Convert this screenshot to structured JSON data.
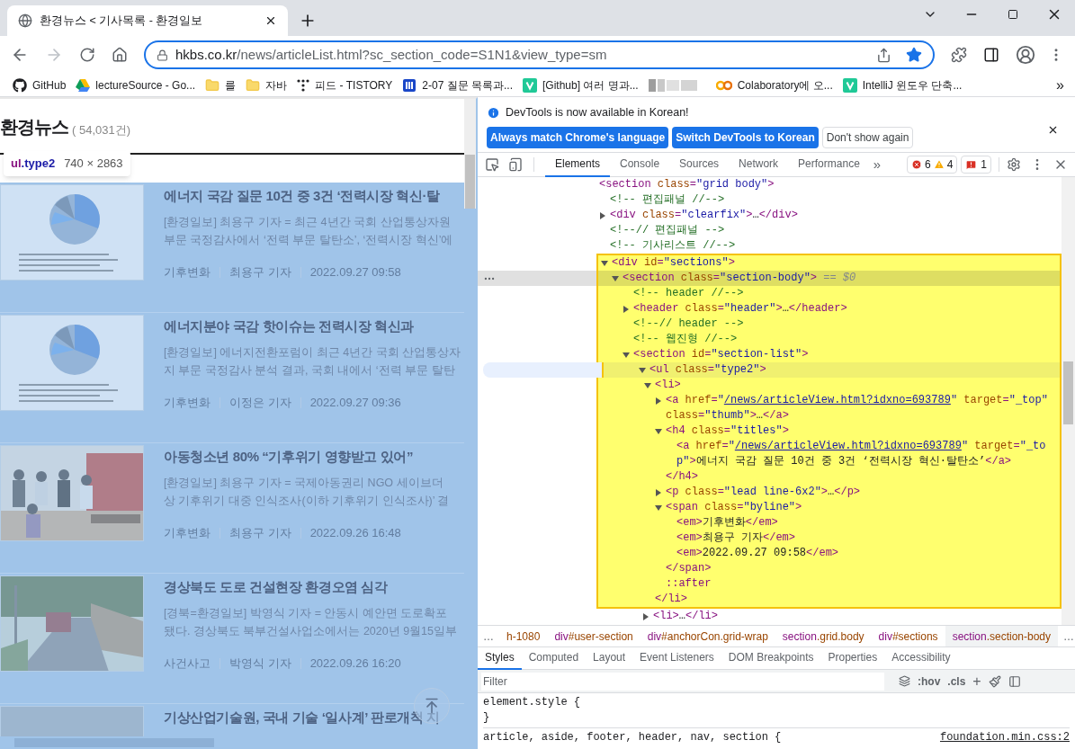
{
  "browser": {
    "tab": {
      "title": "환경뉴스 < 기사목록 - 환경일보",
      "selected": true
    },
    "url": {
      "host": "hkbs.co.kr",
      "path": "/news/articleList.html?sc_section_code=S1N1&view_type=sm"
    },
    "bookmarked": true,
    "bookmarks": [
      {
        "kind": "github",
        "label": "GitHub"
      },
      {
        "kind": "drive",
        "label": "lectureSource - Go..."
      },
      {
        "kind": "folder",
        "label": "를"
      },
      {
        "kind": "folder",
        "label": "자바"
      },
      {
        "kind": "dots",
        "label": "피드 - TISTORY"
      },
      {
        "kind": "bars",
        "label": "2-07 질문 목록과..."
      },
      {
        "kind": "v",
        "label": "[Github] 여러 명과..."
      },
      {
        "kind": "blurred"
      },
      {
        "kind": "colab",
        "label": "Colaboratory에 오..."
      },
      {
        "kind": "v",
        "label": "IntelliJ 윈도우 단축..."
      }
    ],
    "bookmarks_more": "»"
  },
  "page": {
    "heading": "환경뉴스",
    "count": "( 54,031건)",
    "tooltip": {
      "tag": "ul",
      "cls": ".type2",
      "size": "740 × 2863"
    },
    "articles": [
      {
        "title": "에너지 국감 질문 10건 중 3건 ‘전력시장 혁신·탈",
        "lead": [
          "[환경일보] 최용구 기자 = 최근 4년간 국회 산업통상자원",
          "부문 국정감사에서 ‘전력 부문 탈탄소’, ‘전력시장 혁신’에"
        ],
        "byline": [
          "기후변화",
          "최용구 기자",
          "2022.09.27 09:58"
        ]
      },
      {
        "title": "에너지분야 국감 핫이슈는 전력시장 혁신과",
        "lead": [
          "[환경일보] 에너지전환포럼이 최근 4년간 국회 산업통상자",
          "지 부문 국정감사 분석 결과, 국회 내에서 ‘전력 부문 탈탄"
        ],
        "byline": [
          "기후변화",
          "이정은 기자",
          "2022.09.27 09:36"
        ]
      },
      {
        "title": "아동청소년 80% “기후위기 영향받고 있어”",
        "lead": [
          "[환경일보] 최용구 기자 = 국제아동권리 NGO 세이브더",
          "상 기후위기 대중 인식조사(이하 기후위기 인식조사)’ 결"
        ],
        "byline": [
          "기후변화",
          "최용구 기자",
          "2022.09.26 16:48"
        ]
      },
      {
        "title": "경상북도 도로 건설현장 환경오염 심각",
        "lead": [
          "[경북=환경일보] 박영식 기자 = 안동시 예안면 도로확포",
          "됐다. 경상북도 북부건설사업소에서는 2020년 9월15일부"
        ],
        "byline": [
          "사건사고",
          "박영식 기자",
          "2022.09.26 16:20"
        ]
      },
      {
        "title": "기상산업기술원, 국내 기술 ‘일사계’ 판로개척 지"
      }
    ]
  },
  "devtools": {
    "notice": {
      "message": "DevTools is now available in Korean!",
      "buttons": [
        {
          "kind": "primary",
          "label": "Always match Chrome's language"
        },
        {
          "kind": "primary",
          "label": "Switch DevTools to Korean"
        },
        {
          "kind": "plain",
          "label": "Don't show again"
        }
      ]
    },
    "tabs": [
      {
        "label": "Elements",
        "selected": true
      },
      {
        "label": "Console",
        "selected": false
      },
      {
        "label": "Sources",
        "selected": false
      },
      {
        "label": "Network",
        "selected": false
      },
      {
        "label": "Performance",
        "selected": false
      }
    ],
    "tabs_more": "»",
    "errors": "6",
    "warnings": "4",
    "issues": "1",
    "tree": {
      "segs": [
        {
          "kind": "tag",
          "text": "<section"
        },
        {
          "kind": "attr",
          "text": " class"
        },
        {
          "kind": "tag",
          "text": "="
        },
        {
          "kind": "value",
          "text": "\"grid body\""
        },
        {
          "kind": "tag",
          "text": ">"
        }
      ],
      "selected": false,
      "hovered": false,
      "highlighted": false,
      "children": [
        {
          "segs": [
            {
              "kind": "comment",
              "text": "<!-- 편집패널 //-->"
            }
          ],
          "selected": false,
          "hovered": false,
          "highlighted": false
        },
        {
          "segs": [
            {
              "kind": "tag",
              "text": "<div"
            },
            {
              "kind": "attr",
              "text": " class"
            },
            {
              "kind": "tag",
              "text": "="
            },
            {
              "kind": "value",
              "text": "\"clearfix\""
            },
            {
              "kind": "tag",
              "text": ">"
            },
            {
              "kind": "text",
              "text": "…"
            },
            {
              "kind": "tag",
              "text": "</div>"
            }
          ],
          "expanded": false,
          "selected": false,
          "hovered": false,
          "highlighted": false
        },
        {
          "segs": [
            {
              "kind": "comment",
              "text": "<!--// 편집패널 -->"
            }
          ],
          "selected": false,
          "hovered": false,
          "highlighted": false
        },
        {
          "segs": [
            {
              "kind": "comment",
              "text": "<!-- 기사리스트 //-->"
            }
          ],
          "selected": false,
          "hovered": false,
          "highlighted": false
        },
        {
          "segs": [
            {
              "kind": "tag",
              "text": "<div"
            },
            {
              "kind": "attr",
              "text": " id"
            },
            {
              "kind": "tag",
              "text": "="
            },
            {
              "kind": "value",
              "text": "\"sections\""
            },
            {
              "kind": "tag",
              "text": ">"
            }
          ],
          "expanded": true,
          "selected": false,
          "hovered": false,
          "highlighted": true,
          "children": [
            {
              "segs": [
                {
                  "kind": "tag",
                  "text": "<section"
                },
                {
                  "kind": "attr",
                  "text": " class"
                },
                {
                  "kind": "tag",
                  "text": "="
                },
                {
                  "kind": "value",
                  "text": "\"section-body\""
                },
                {
                  "kind": "tag",
                  "text": ">"
                },
                {
                  "kind": "hint",
                  "text": " == $0"
                }
              ],
              "expanded": true,
              "selected": true,
              "hovered": false,
              "highlighted": true,
              "children": [
                {
                  "segs": [
                    {
                      "kind": "comment",
                      "text": "<!-- header //-->"
                    }
                  ],
                  "selected": false,
                  "hovered": false,
                  "highlighted": true
                },
                {
                  "segs": [
                    {
                      "kind": "tag",
                      "text": "<header"
                    },
                    {
                      "kind": "attr",
                      "text": " class"
                    },
                    {
                      "kind": "tag",
                      "text": "="
                    },
                    {
                      "kind": "value",
                      "text": "\"header\""
                    },
                    {
                      "kind": "tag",
                      "text": ">"
                    },
                    {
                      "kind": "text",
                      "text": "…"
                    },
                    {
                      "kind": "tag",
                      "text": "</header>"
                    }
                  ],
                  "expanded": false,
                  "selected": false,
                  "hovered": false,
                  "highlighted": true
                },
                {
                  "segs": [
                    {
                      "kind": "comment",
                      "text": "<!--// header -->"
                    }
                  ],
                  "selected": false,
                  "hovered": false,
                  "highlighted": true
                },
                {
                  "segs": [
                    {
                      "kind": "comment",
                      "text": "<!-- 웹진형 //-->"
                    }
                  ],
                  "selected": false,
                  "hovered": false,
                  "highlighted": true
                },
                {
                  "segs": [
                    {
                      "kind": "tag",
                      "text": "<section"
                    },
                    {
                      "kind": "attr",
                      "text": " id"
                    },
                    {
                      "kind": "tag",
                      "text": "="
                    },
                    {
                      "kind": "value",
                      "text": "\"section-list\""
                    },
                    {
                      "kind": "tag",
                      "text": ">"
                    }
                  ],
                  "expanded": true,
                  "selected": false,
                  "hovered": false,
                  "highlighted": true,
                  "children": [
                    {
                      "segs": [
                        {
                          "kind": "tag",
                          "text": "<ul"
                        },
                        {
                          "kind": "attr",
                          "text": " class"
                        },
                        {
                          "kind": "tag",
                          "text": "="
                        },
                        {
                          "kind": "value",
                          "text": "\"type2\""
                        },
                        {
                          "kind": "tag",
                          "text": ">"
                        }
                      ],
                      "expanded": true,
                      "selected": false,
                      "hovered": true,
                      "highlighted": true,
                      "children": [
                        {
                          "segs": [
                            {
                              "kind": "tag",
                              "text": "<li>"
                            }
                          ],
                          "expanded": true,
                          "close": "</li>",
                          "selected": false,
                          "hovered": false,
                          "highlighted": true,
                          "children": [
                            {
                              "segs": [
                                {
                                  "kind": "tag",
                                  "text": "<a"
                                },
                                {
                                  "kind": "attr",
                                  "text": " href"
                                },
                                {
                                  "kind": "tag",
                                  "text": "="
                                },
                                {
                                  "kind": "value",
                                  "text": "\""
                                },
                                {
                                  "kind": "link",
                                  "text": "/news/articleView.html?idxno=693789"
                                },
                                {
                                  "kind": "value",
                                  "text": "\""
                                },
                                {
                                  "kind": "attr",
                                  "text": " target"
                                },
                                {
                                  "kind": "tag",
                                  "text": "="
                                },
                                {
                                  "kind": "value",
                                  "text": "\"_top\""
                                },
                                {
                                  "kind": "attr",
                                  "text": " class"
                                },
                                {
                                  "kind": "tag",
                                  "text": "="
                                },
                                {
                                  "kind": "value",
                                  "text": "\"thumb\""
                                },
                                {
                                  "kind": "tag",
                                  "text": ">"
                                },
                                {
                                  "kind": "text",
                                  "text": "…"
                                },
                                {
                                  "kind": "tag",
                                  "text": "</a>"
                                }
                              ],
                              "expanded": false,
                              "selected": false,
                              "hovered": false,
                              "highlighted": true
                            },
                            {
                              "segs": [
                                {
                                  "kind": "tag",
                                  "text": "<h4"
                                },
                                {
                                  "kind": "attr",
                                  "text": " class"
                                },
                                {
                                  "kind": "tag",
                                  "text": "="
                                },
                                {
                                  "kind": "value",
                                  "text": "\"titles\""
                                },
                                {
                                  "kind": "tag",
                                  "text": ">"
                                }
                              ],
                              "expanded": true,
                              "close": "</h4>",
                              "selected": false,
                              "hovered": false,
                              "highlighted": true,
                              "children": [
                                {
                                  "segs": [
                                    {
                                      "kind": "tag",
                                      "text": "<a"
                                    },
                                    {
                                      "kind": "attr",
                                      "text": " href"
                                    },
                                    {
                                      "kind": "tag",
                                      "text": "="
                                    },
                                    {
                                      "kind": "value",
                                      "text": "\""
                                    },
                                    {
                                      "kind": "link",
                                      "text": "/news/articleView.html?idxno=693789"
                                    },
                                    {
                                      "kind": "value",
                                      "text": "\""
                                    },
                                    {
                                      "kind": "attr",
                                      "text": " target"
                                    },
                                    {
                                      "kind": "tag",
                                      "text": "="
                                    },
                                    {
                                      "kind": "value",
                                      "text": "\"_top\""
                                    },
                                    {
                                      "kind": "tag",
                                      "text": ">"
                                    },
                                    {
                                      "kind": "text",
                                      "text": "에너지 국감 질문 10건 중 3건 ‘전력시장 혁신·탈탄소’"
                                    },
                                    {
                                      "kind": "tag",
                                      "text": "</a>"
                                    }
                                  ],
                                  "selected": false,
                                  "hovered": false,
                                  "highlighted": true
                                }
                              ]
                            },
                            {
                              "segs": [
                                {
                                  "kind": "tag",
                                  "text": "<p"
                                },
                                {
                                  "kind": "attr",
                                  "text": " class"
                                },
                                {
                                  "kind": "tag",
                                  "text": "="
                                },
                                {
                                  "kind": "value",
                                  "text": "\"lead line-6x2\""
                                },
                                {
                                  "kind": "tag",
                                  "text": ">"
                                },
                                {
                                  "kind": "text",
                                  "text": "…"
                                },
                                {
                                  "kind": "tag",
                                  "text": "</p>"
                                }
                              ],
                              "expanded": false,
                              "selected": false,
                              "hovered": false,
                              "highlighted": true
                            },
                            {
                              "segs": [
                                {
                                  "kind": "tag",
                                  "text": "<span"
                                },
                                {
                                  "kind": "attr",
                                  "text": " class"
                                },
                                {
                                  "kind": "tag",
                                  "text": "="
                                },
                                {
                                  "kind": "value",
                                  "text": "\"byline\""
                                },
                                {
                                  "kind": "tag",
                                  "text": ">"
                                }
                              ],
                              "expanded": true,
                              "close": "</span>",
                              "selected": false,
                              "hovered": false,
                              "highlighted": true,
                              "children": [
                                {
                                  "segs": [
                                    {
                                      "kind": "tag",
                                      "text": "<em>"
                                    },
                                    {
                                      "kind": "text",
                                      "text": "기후변화"
                                    },
                                    {
                                      "kind": "tag",
                                      "text": "</em>"
                                    }
                                  ],
                                  "selected": false,
                                  "hovered": false,
                                  "highlighted": true
                                },
                                {
                                  "segs": [
                                    {
                                      "kind": "tag",
                                      "text": "<em>"
                                    },
                                    {
                                      "kind": "text",
                                      "text": "최용구 기자"
                                    },
                                    {
                                      "kind": "tag",
                                      "text": "</em>"
                                    }
                                  ],
                                  "selected": false,
                                  "hovered": false,
                                  "highlighted": true
                                },
                                {
                                  "segs": [
                                    {
                                      "kind": "tag",
                                      "text": "<em>"
                                    },
                                    {
                                      "kind": "text",
                                      "text": "2022.09.27 09:58"
                                    },
                                    {
                                      "kind": "tag",
                                      "text": "</em>"
                                    }
                                  ],
                                  "selected": false,
                                  "hovered": false,
                                  "highlighted": true
                                }
                              ]
                            },
                            {
                              "segs": [
                                {
                                  "kind": "pseudo",
                                  "text": "::after"
                                }
                              ],
                              "selected": false,
                              "hovered": false,
                              "highlighted": true
                            }
                          ]
                        },
                        {
                          "segs": [
                            {
                              "kind": "tag",
                              "text": "<li>"
                            },
                            {
                              "kind": "text",
                              "text": "…"
                            },
                            {
                              "kind": "tag",
                              "text": "</li>"
                            }
                          ],
                          "expanded": false,
                          "selected": false,
                          "hovered": false,
                          "highlighted": false
                        }
                      ]
                    }
                  ]
                }
              ]
            }
          ]
        }
      ]
    },
    "crumbs": [
      {
        "kind": "more",
        "text": "…"
      },
      {
        "kind": "node",
        "rest": "h-1080",
        "selected": false
      },
      {
        "kind": "node",
        "tag": "div",
        "rest": "#user-section",
        "selected": false
      },
      {
        "kind": "node",
        "tag": "div",
        "rest": "#anchorCon.grid-wrap",
        "selected": false
      },
      {
        "kind": "node",
        "tag": "section",
        "rest": ".grid.body",
        "selected": false
      },
      {
        "kind": "node",
        "tag": "div",
        "rest": "#sections",
        "selected": false
      },
      {
        "kind": "node",
        "tag": "section",
        "rest": ".section-body",
        "selected": true
      },
      {
        "kind": "more",
        "text": "…"
      }
    ],
    "style_tabs": [
      {
        "label": "Styles",
        "selected": true
      },
      {
        "label": "Computed",
        "selected": false
      },
      {
        "label": "Layout",
        "selected": false
      },
      {
        "label": "Event Listeners",
        "selected": false
      },
      {
        "label": "DOM Breakpoints",
        "selected": false
      },
      {
        "label": "Properties",
        "selected": false
      },
      {
        "label": "Accessibility",
        "selected": false
      }
    ],
    "filter": {
      "placeholder": "Filter"
    },
    "hov": ":hov",
    "cls": ".cls",
    "add": "+",
    "rules": [
      {
        "header": "element.style {",
        "footer": "}"
      },
      {
        "header": "article, aside, footer, header, nav, section {",
        "source": "foundation.min.css:2"
      }
    ]
  }
}
